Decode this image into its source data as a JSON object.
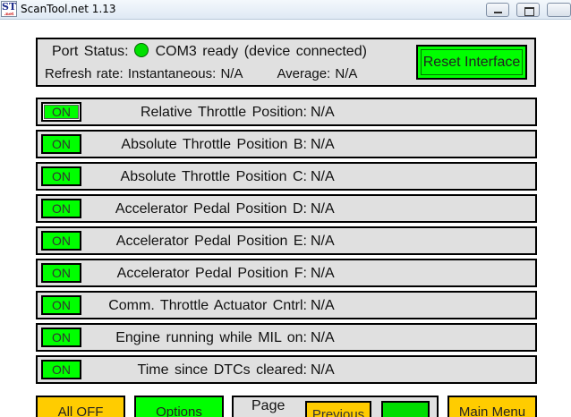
{
  "window": {
    "title": "ScanTool.net 1.13",
    "icon_text": "ST",
    "icon_subtext": ".net"
  },
  "status": {
    "port_label": "Port Status:",
    "port_value": "COM3 ready (device connected)",
    "led_color": "#00e000",
    "refresh_label": "Refresh rate: Instantaneous: N/A",
    "average_label": "Average: N/A",
    "reset_button": "Reset Interface"
  },
  "sensors": [
    {
      "toggle": "ON",
      "label": "Relative Throttle Position:",
      "value": "N/A"
    },
    {
      "toggle": "ON",
      "label": "Absolute Throttle Position B:",
      "value": "N/A"
    },
    {
      "toggle": "ON",
      "label": "Absolute Throttle Position C:",
      "value": "N/A"
    },
    {
      "toggle": "ON",
      "label": "Accelerator Pedal Position D:",
      "value": "N/A"
    },
    {
      "toggle": "ON",
      "label": "Accelerator Pedal Position E:",
      "value": "N/A"
    },
    {
      "toggle": "ON",
      "label": "Accelerator Pedal Position F:",
      "value": "N/A"
    },
    {
      "toggle": "ON",
      "label": "Comm. Throttle Actuator Cntrl:",
      "value": "N/A"
    },
    {
      "toggle": "ON",
      "label": "Engine running while MIL on:",
      "value": "N/A"
    },
    {
      "toggle": "ON",
      "label": "Time since DTCs cleared:",
      "value": "N/A"
    }
  ],
  "bottom": {
    "all_off": "All OFF",
    "options": "Options",
    "page_label": "Page",
    "page_indicator": "",
    "previous": "Previous",
    "next": "",
    "main_menu": "Main Menu"
  },
  "colors": {
    "green": "#00ff00",
    "yellow": "#ffcc00",
    "panel": "#e0e0e0"
  }
}
